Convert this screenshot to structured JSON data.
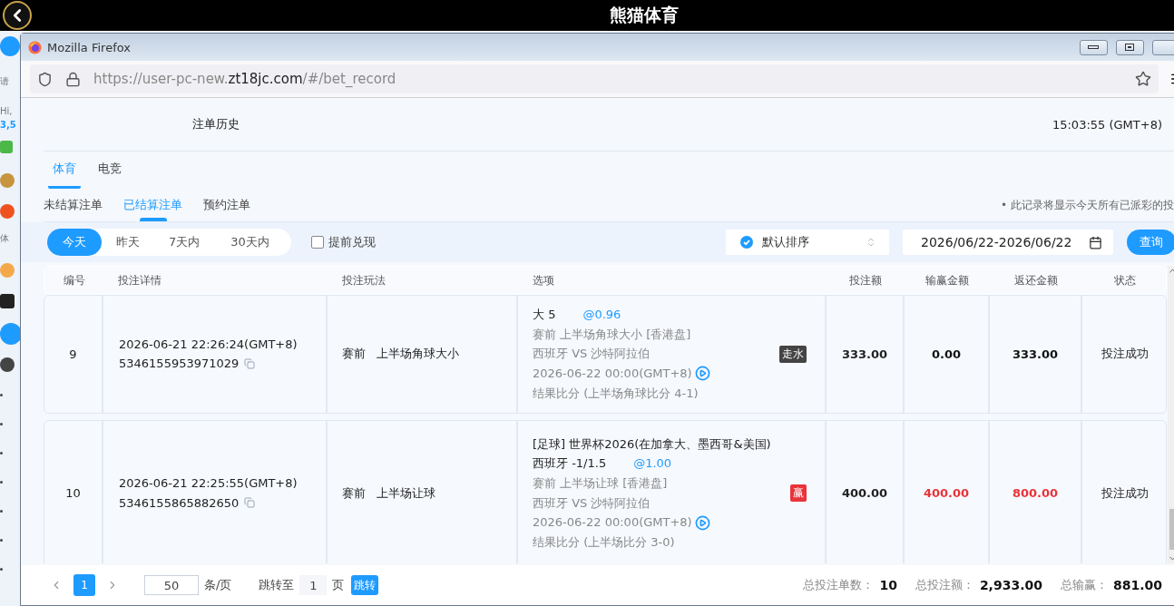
{
  "top_bar": {
    "title": "熊猫体育"
  },
  "background_app": {
    "fragments": [
      {
        "text": "请",
        "kind": "hint"
      },
      {
        "text": "Hi,",
        "kind": "greeting"
      },
      {
        "text": "3,5",
        "kind": "amount"
      },
      {
        "text": "体",
        "kind": "label"
      }
    ]
  },
  "browser": {
    "title": "Mozilla Firefox",
    "url": {
      "prefix": "https://user-pc-new.",
      "domain": "zt18jc.com",
      "path": "/#/bet_record"
    }
  },
  "page": {
    "title": "注单历史",
    "clock": "15:03:55 (GMT+8)",
    "category_tabs": [
      {
        "label": "体育",
        "selected": true
      },
      {
        "label": "电竞",
        "selected": false
      }
    ],
    "record_tabs": [
      {
        "label": "未结算注单",
        "selected": false
      },
      {
        "label": "已结算注单",
        "selected": true
      },
      {
        "label": "预约注单",
        "selected": false
      }
    ],
    "note": "• 此记录将显示今天所有已派彩的投",
    "date_ranges": [
      {
        "label": "今天",
        "selected": true
      },
      {
        "label": "昨天",
        "selected": false
      },
      {
        "label": "7天内",
        "selected": false
      },
      {
        "label": "30天内",
        "selected": false
      }
    ],
    "cash_out": {
      "label": "提前兑现",
      "checked": false
    },
    "sort": {
      "value": "默认排序"
    },
    "date_range": {
      "value": "2026/06/22-2026/06/22"
    },
    "query_button": "查询",
    "table": {
      "columns": [
        "编号",
        "投注详情",
        "投注玩法",
        "选项",
        "投注额",
        "输赢金额",
        "返还金额",
        "状态"
      ],
      "rows": [
        {
          "number": "9",
          "time": "2026-06-21 22:26:24(GMT+8)",
          "bet_id": "5346155953971029",
          "stage": "赛前",
          "market": "上半场角球大小",
          "selection": {
            "pick": "大 5",
            "odds": "@0.96",
            "market_line": "赛前 上半场角球大小 [香港盘]",
            "match": "西班牙 VS 沙特阿拉伯",
            "kickoff": "2026-06-22 00:00(GMT+8)",
            "result": "结果比分 (上半场角球比分 4-1)"
          },
          "outcome": {
            "kind": "push",
            "label": "走水"
          },
          "stake": "333.00",
          "win_loss": "0.00",
          "return": "333.00",
          "status": "投注成功"
        },
        {
          "number": "10",
          "time": "2026-06-21 22:25:55(GMT+8)",
          "bet_id": "5346155865882650",
          "stage": "赛前",
          "market": "上半场让球",
          "selection": {
            "league": "[足球] 世界杯2026(在加拿大、墨西哥&美国)",
            "pick": "西班牙 -1/1.5",
            "odds": "@1.00",
            "market_line": "赛前 上半场让球 [香港盘]",
            "match": "西班牙 VS 沙特阿拉伯",
            "kickoff": "2026-06-22 00:00(GMT+8)",
            "result": "结果比分 (上半场比分 3-0)"
          },
          "outcome": {
            "kind": "win",
            "label": "赢"
          },
          "stake": "400.00",
          "win_loss": "400.00",
          "return": "800.00",
          "status": "投注成功"
        }
      ]
    },
    "pagination": {
      "pages": [
        {
          "label": "1",
          "selected": true
        }
      ],
      "page_size": "50",
      "page_size_unit": "条/页",
      "jump_label": "跳转至",
      "jump_value": "1",
      "page_unit": "页",
      "jump_button": "跳转"
    },
    "summary": [
      {
        "label": "总投注单数：",
        "value": "10"
      },
      {
        "label": "总投注额：",
        "value": "2,933.00"
      },
      {
        "label": "总输赢：",
        "value": "881.00"
      }
    ]
  }
}
